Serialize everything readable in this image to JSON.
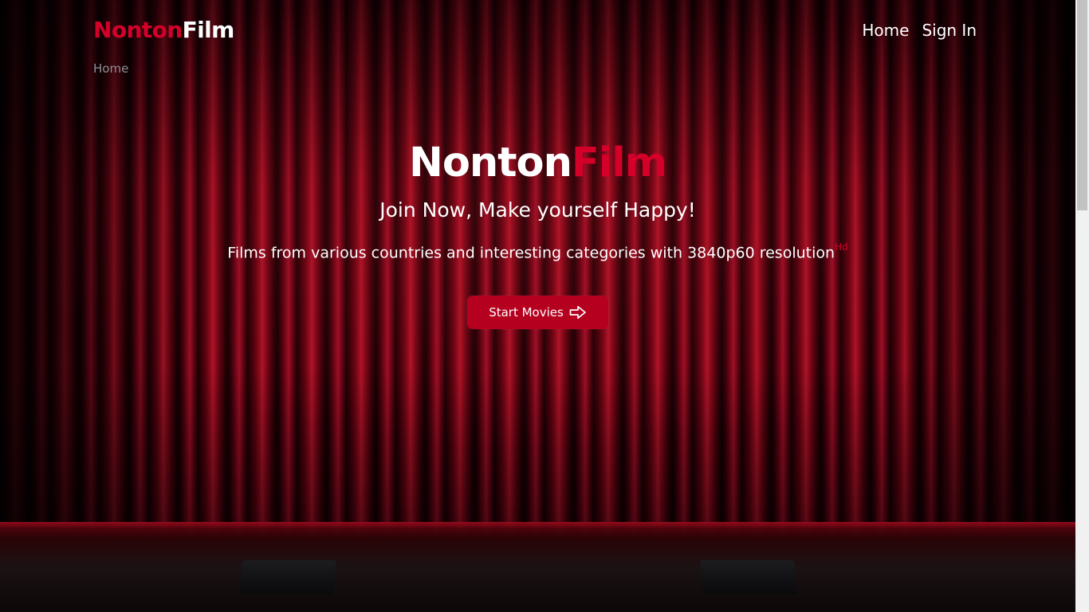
{
  "brand": {
    "part1": "Nonton",
    "part2": "Film",
    "accent_color": "#d4002a"
  },
  "nav": {
    "items": [
      {
        "label": "Home"
      },
      {
        "label": "Sign In"
      }
    ]
  },
  "breadcrumb": {
    "current": "Home"
  },
  "hero": {
    "title_part1": "Nonton",
    "title_part2": "Film",
    "tagline": "Join Now, Make yourself Happy!",
    "description": "Films from various countries and interesting categories with 3840p60 resolution",
    "description_badge": "Hd",
    "cta_label": "Start Movies",
    "cta_icon": "arrow-right-icon",
    "cta_color": "#b5001f"
  }
}
